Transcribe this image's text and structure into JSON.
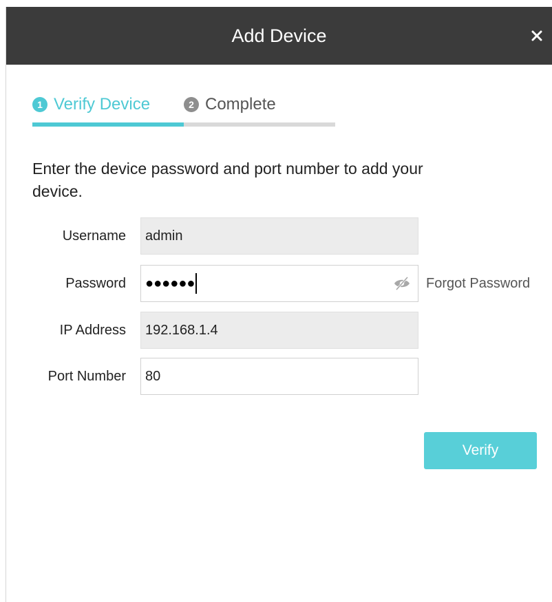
{
  "dialog": {
    "title": "Add Device",
    "close_glyph": "×"
  },
  "steps": {
    "items": [
      {
        "number": "1",
        "label": "Verify Device",
        "active": true
      },
      {
        "number": "2",
        "label": "Complete",
        "active": false
      }
    ],
    "progress_fraction": 0.5
  },
  "instructions": "Enter the device password and port number to add your device.",
  "form": {
    "username": {
      "label": "Username",
      "value": "admin"
    },
    "password": {
      "label": "Password",
      "value_masked": "●●●●●●",
      "forgot_label": "Forgot Password"
    },
    "ip_address": {
      "label": "IP Address",
      "value": "192.168.1.4"
    },
    "port_number": {
      "label": "Port Number",
      "value": "80"
    }
  },
  "buttons": {
    "verify_label": "Verify"
  },
  "colors": {
    "accent": "#4ec9d4",
    "button": "#58cfd8",
    "titlebar": "#3b3b3b"
  },
  "icons": {
    "close": "close-icon",
    "password_visibility": "eye-off-icon"
  }
}
